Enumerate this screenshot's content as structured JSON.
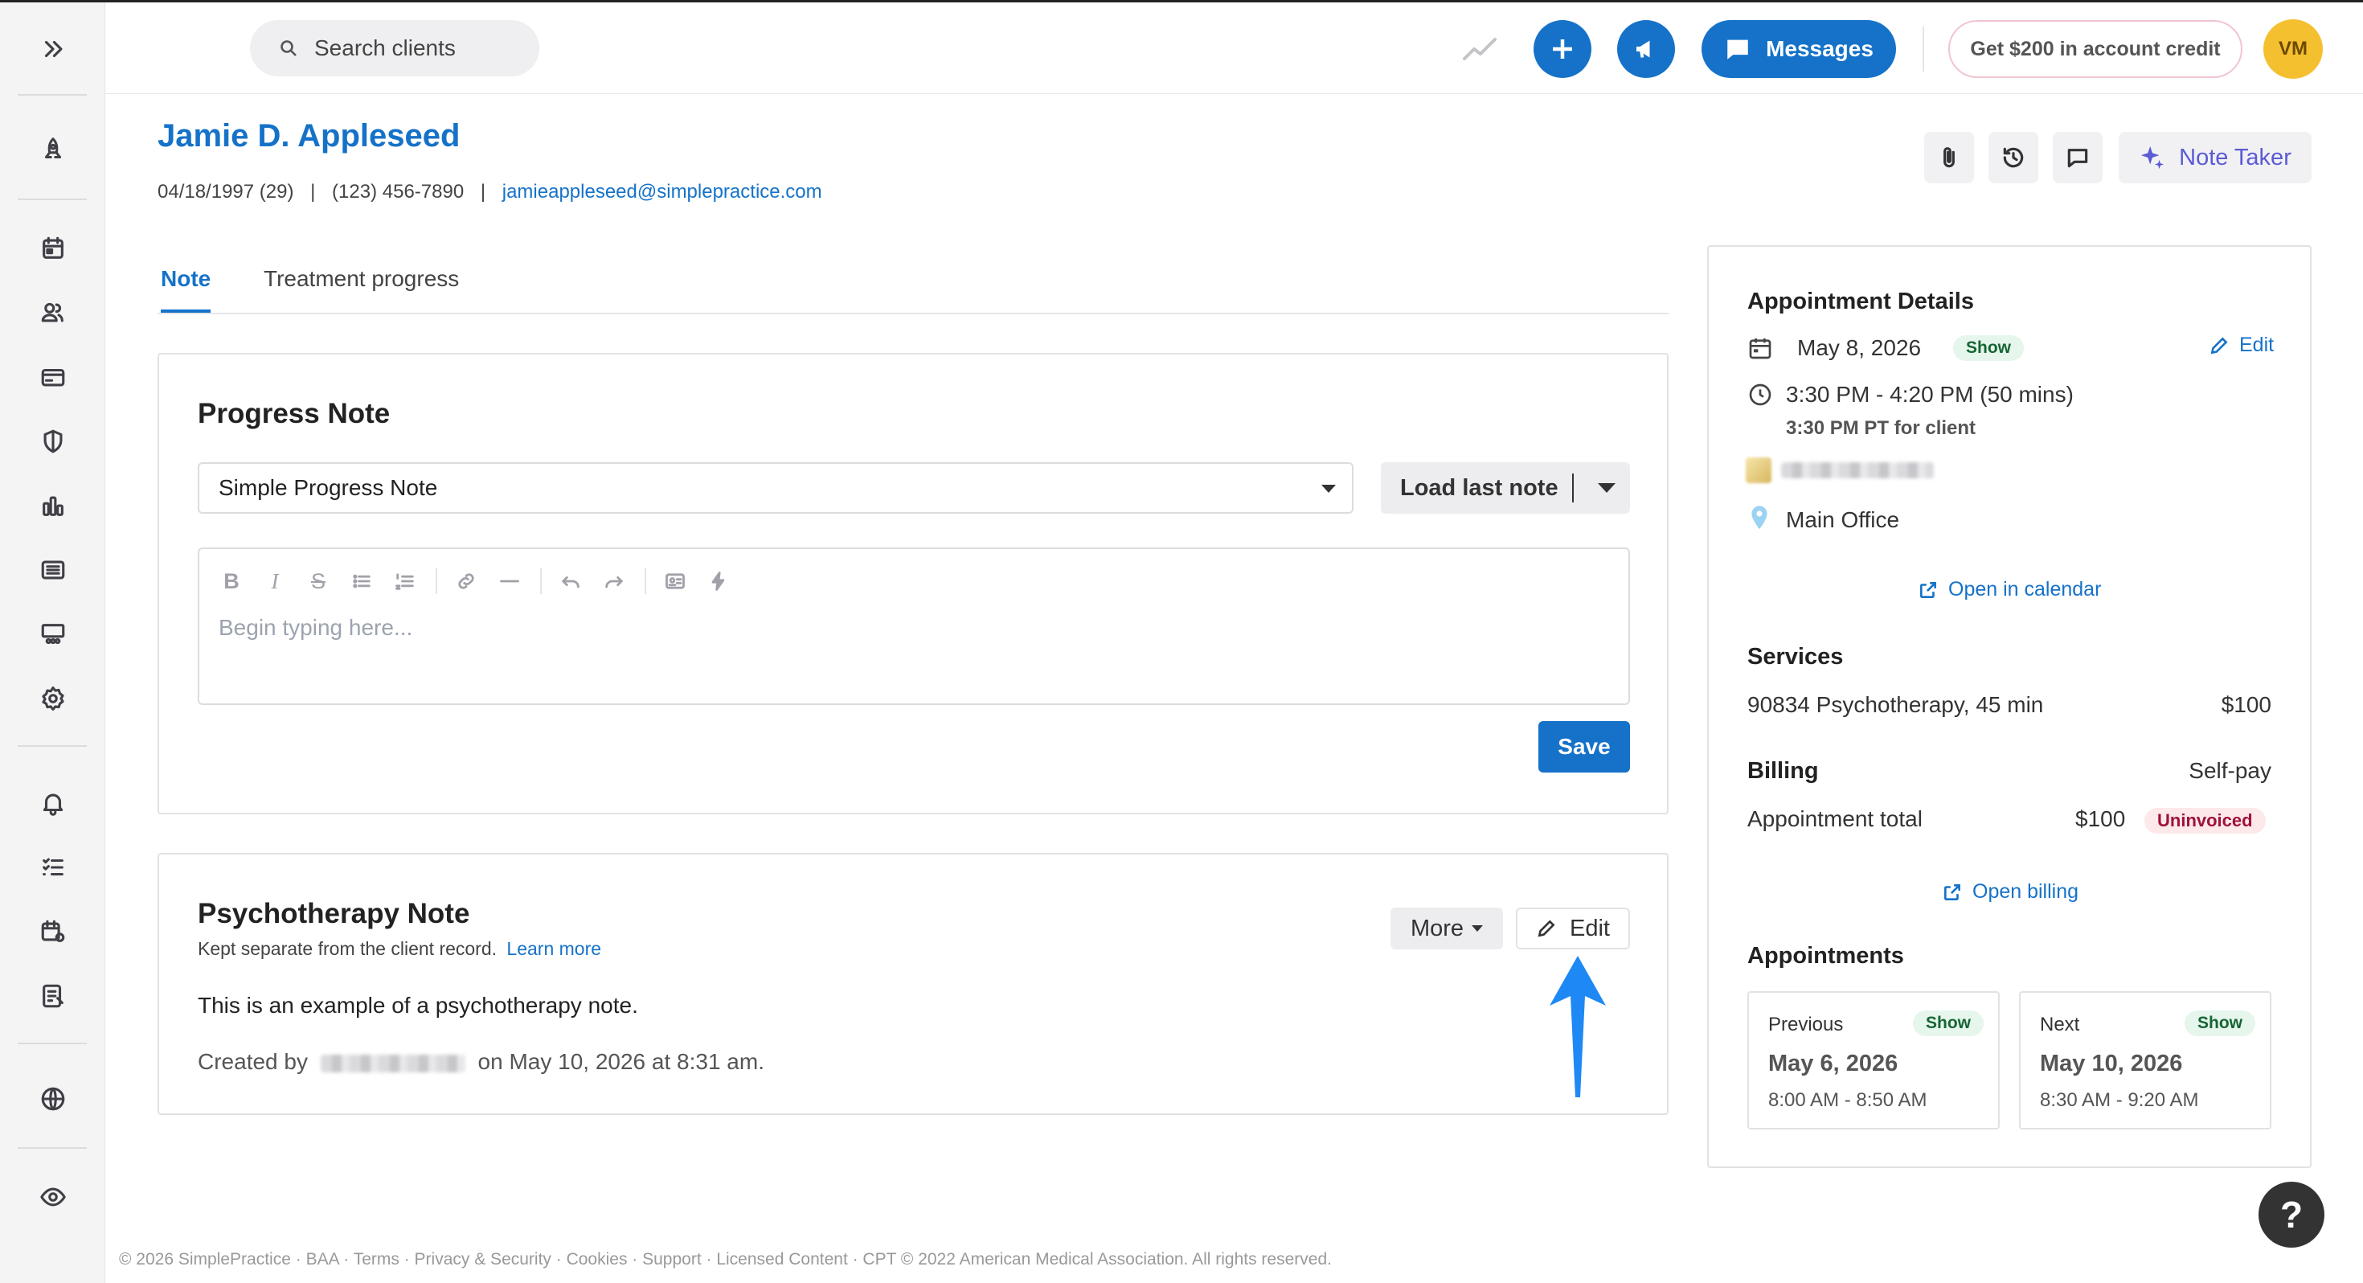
{
  "search": {
    "placeholder": "Search clients"
  },
  "topbar": {
    "messages_label": "Messages",
    "credit_label": "Get $200 in account credit",
    "avatar_initials": "VM"
  },
  "client": {
    "name": "Jamie D. Appleseed",
    "dob": "04/18/1997 (29)",
    "phone": "(123) 456-7890",
    "email": "jamieappleseed@simplepractice.com",
    "note_taker_label": "Note Taker"
  },
  "tabs": [
    {
      "label": "Note",
      "active": true
    },
    {
      "label": "Treatment progress",
      "active": false
    }
  ],
  "progress_note": {
    "title": "Progress Note",
    "template_value": "Simple Progress Note",
    "load_last_label": "Load last note",
    "editor_placeholder": "Begin typing here...",
    "save_label": "Save"
  },
  "psychotherapy_note": {
    "title": "Psychotherapy Note",
    "subtitle": "Kept separate from the client record.",
    "learn_more": "Learn more",
    "more_label": "More",
    "edit_label": "Edit",
    "body": "This is an example of a psychotherapy note.",
    "created_prefix": "Created by",
    "created_suffix": "on May 10, 2026 at 8:31 am."
  },
  "appointment": {
    "heading": "Appointment Details",
    "date": "May 8, 2026",
    "status": "Show",
    "edit_label": "Edit",
    "time": "3:30 PM - 4:20 PM (50 mins)",
    "client_time": "3:30 PM PT for client",
    "location": "Main Office",
    "open_calendar": "Open in calendar",
    "services_heading": "Services",
    "service_name": "90834 Psychotherapy, 45 min",
    "service_price": "$100",
    "billing_heading": "Billing",
    "billing_type": "Self-pay",
    "total_label": "Appointment total",
    "total_value": "$100",
    "invoice_status": "Uninvoiced",
    "open_billing": "Open billing",
    "appointments_heading": "Appointments",
    "previous": {
      "label": "Previous",
      "status": "Show",
      "date": "May 6, 2026",
      "time": "8:00 AM - 8:50 AM"
    },
    "next": {
      "label": "Next",
      "status": "Show",
      "date": "May 10, 2026",
      "time": "8:30 AM - 9:20 AM"
    }
  },
  "help_label": "?",
  "footer": "© 2026 SimplePractice · BAA · Terms · Privacy & Security · Cookies · Support · Licensed Content · CPT © 2022 American Medical Association. All rights reserved.",
  "colors": {
    "accent": "#1572c8",
    "avatar": "#f5c030",
    "note_taker": "#5b5bd6"
  }
}
